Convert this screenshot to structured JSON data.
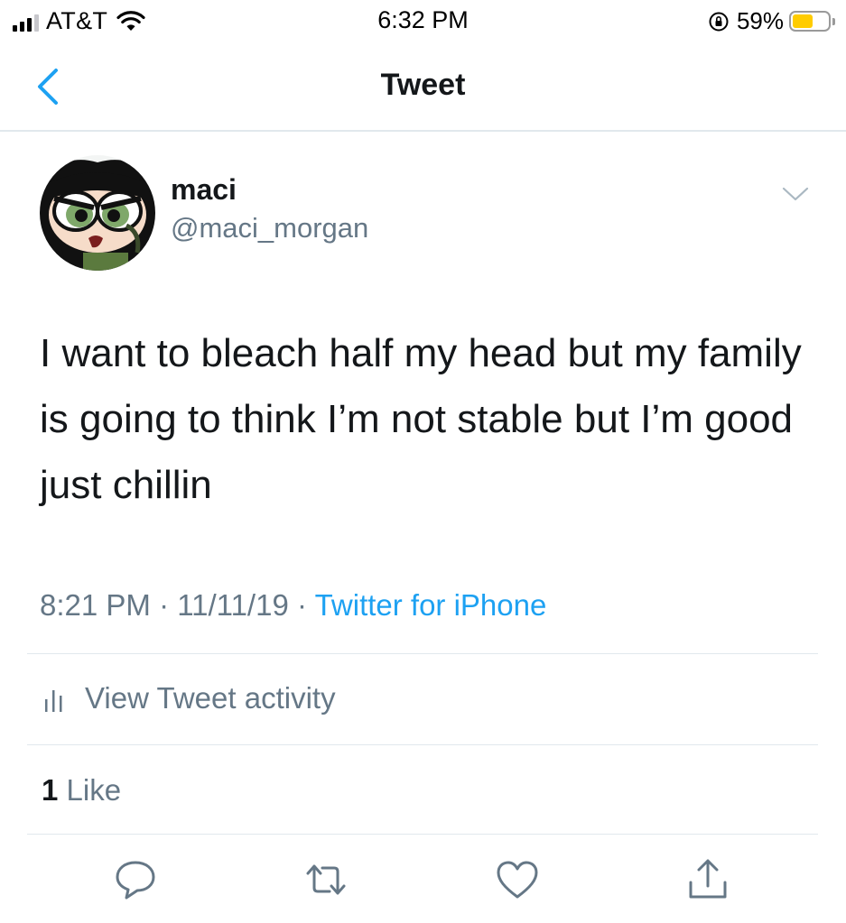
{
  "status_bar": {
    "carrier": "AT&T",
    "time": "6:32 PM",
    "battery_percent": "59%",
    "battery_level": 0.59,
    "battery_color": "#ffcc00"
  },
  "nav": {
    "title": "Tweet",
    "back_icon": "chevron-left-icon"
  },
  "tweet": {
    "display_name": "maci",
    "handle": "@maci_morgan",
    "text": "I want to bleach half my head but my family is going to think I’m not stable but I’m good just chillin",
    "time": "8:21 PM",
    "date": "11/11/19",
    "separator": "·",
    "source": "Twitter for iPhone"
  },
  "activity": {
    "label": "View Tweet activity",
    "icon": "bar-chart-icon"
  },
  "likes": {
    "count": "1",
    "label": "Like"
  },
  "actions": [
    "reply-icon",
    "retweet-icon",
    "like-icon",
    "share-icon"
  ],
  "colors": {
    "accent": "#1da1f2",
    "secondary_text": "#657786",
    "divider": "#e1e8ed"
  }
}
